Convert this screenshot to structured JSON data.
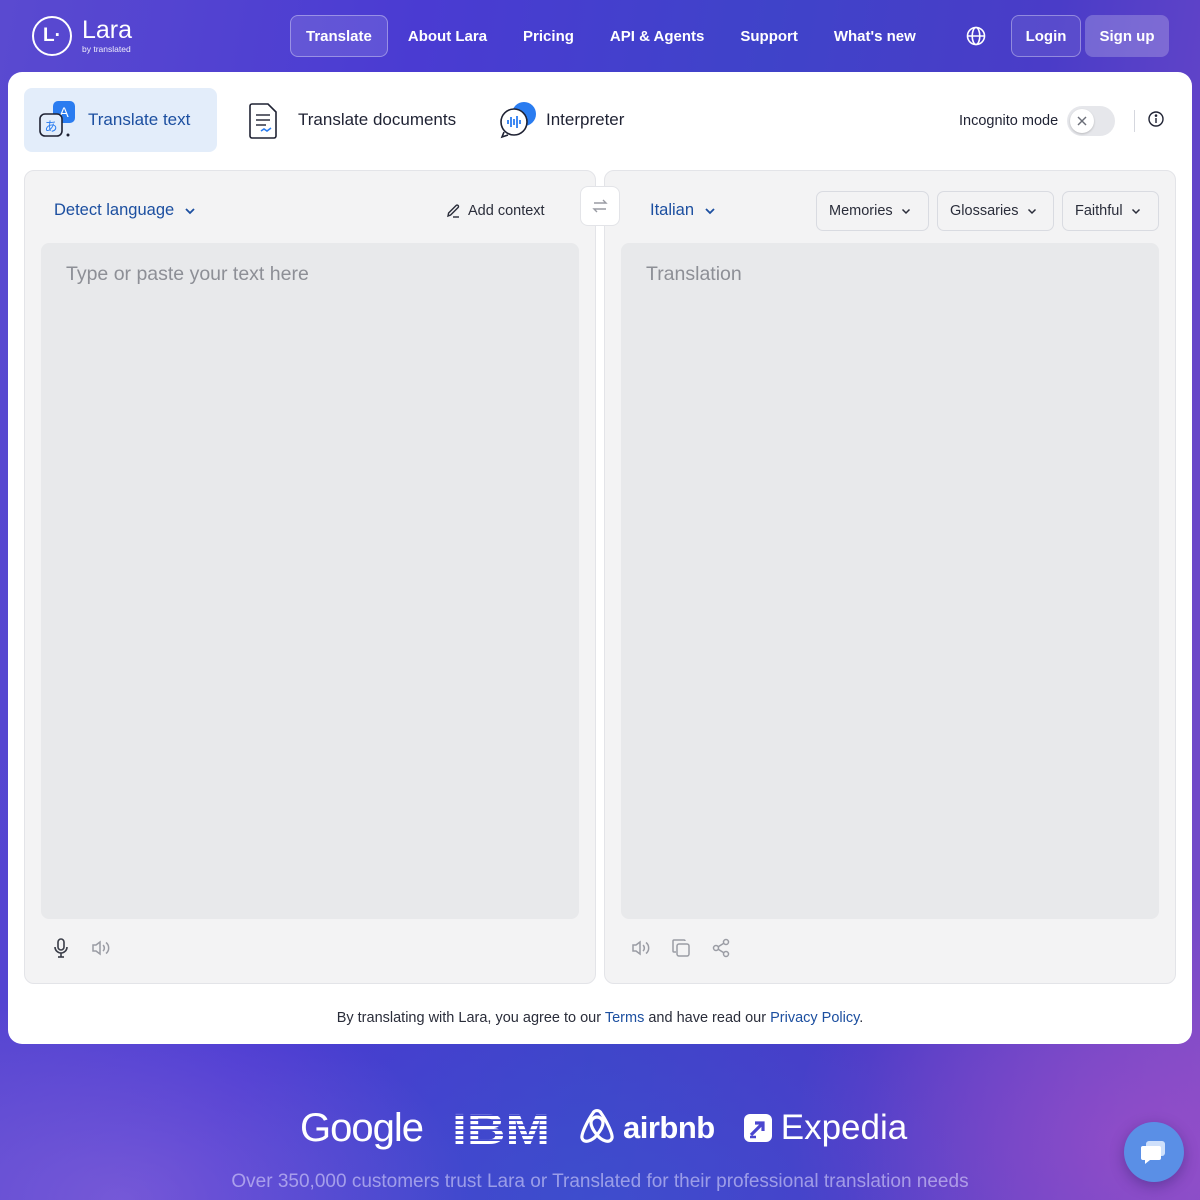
{
  "header": {
    "logo_name": "Lara",
    "logo_sub": "by translated",
    "logo_mark": "L·",
    "nav": [
      "Translate",
      "About Lara",
      "Pricing",
      "API & Agents",
      "Support",
      "What's new"
    ],
    "language_icon": "globe-icon",
    "login": "Login",
    "signup": "Sign up"
  },
  "tabs": {
    "translate_text": "Translate text",
    "translate_documents": "Translate documents",
    "interpreter": "Interpreter"
  },
  "incognito": {
    "label": "Incognito mode",
    "enabled": false
  },
  "source": {
    "language": "Detect language",
    "add_context": "Add context",
    "placeholder": "Type or paste your text here"
  },
  "target": {
    "language": "Italian",
    "memories": "Memories",
    "glossaries": "Glossaries",
    "style": "Faithful",
    "placeholder": "Translation"
  },
  "legal": {
    "prefix": "By translating with Lara, you agree to our ",
    "terms": "Terms",
    "middle": " and have read our ",
    "privacy": "Privacy Policy",
    "suffix": "."
  },
  "brands": {
    "google": "Google",
    "ibm": "IBM",
    "airbnb": "airbnb",
    "expedia": "Expedia"
  },
  "trust_text": "Over 350,000 customers trust Lara or Translated for their professional translation needs",
  "colors": {
    "accent": "#1c4fa0",
    "active_tab_bg": "#e3edfa",
    "panel_bg": "#f3f3f4"
  }
}
